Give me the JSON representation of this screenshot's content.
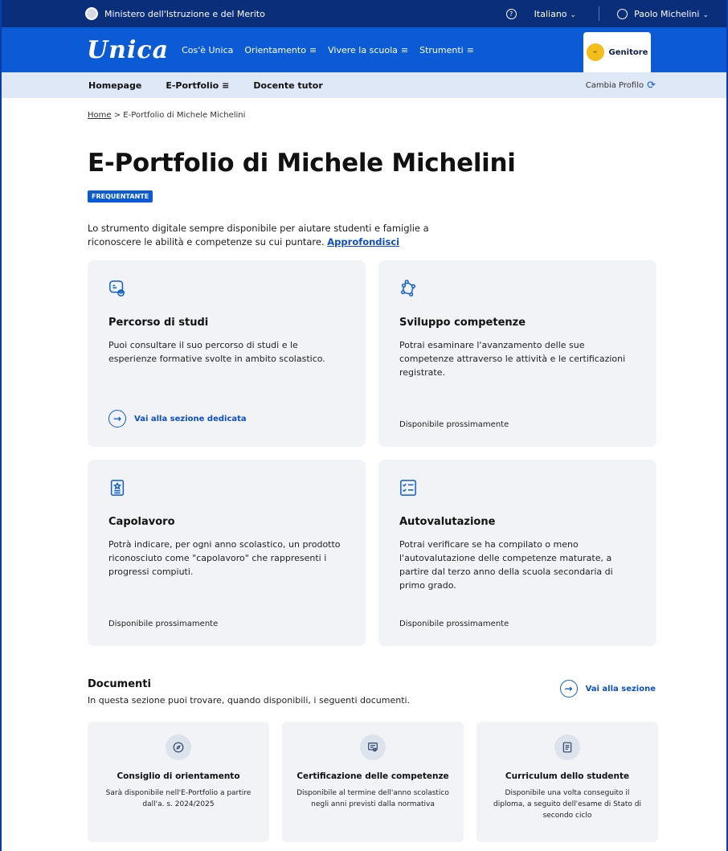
{
  "topbar": {
    "ministry": "Ministero dell'Istruzione e del Merito",
    "language": "Italiano",
    "user": "Paolo Michelini"
  },
  "mainnav": {
    "logo": "Unica",
    "items": [
      "Cos'è Unica",
      "Orientamento",
      "Vivere la scuola",
      "Strumenti"
    ],
    "profile": "Genitore"
  },
  "subnav": {
    "items": [
      "Homepage",
      "E-Portfolio",
      "Docente tutor"
    ],
    "cambia": "Cambia Profilo"
  },
  "breadcrumb": {
    "home": "Home",
    "sep": ">",
    "current": "E-Portfolio di Michele Michelini"
  },
  "page": {
    "title": "E-Portfolio di Michele Michelini",
    "badge": "FREQUENTANTE",
    "intro": "Lo strumento digitale sempre disponibile per aiutare studenti e famiglie a riconoscere le abilità e competenze su cui puntare.",
    "intro_link": "Approfondisci"
  },
  "cards": [
    {
      "title": "Percorso di studi",
      "text": "Puoi consultare il suo percorso di studi e le esperienze formative svolte in ambito scolastico.",
      "link": "Vai alla sezione dedicata",
      "icon": "student-chat-icon"
    },
    {
      "title": "Sviluppo competenze",
      "text": "Potrai esaminare l'avanzamento delle sue competenze attraverso le attività e le certificazioni registrate.",
      "footer": "Disponibile prossimamente",
      "icon": "polygon-nodes-icon"
    },
    {
      "title": "Capolavoro",
      "text": "Potrà indicare, per ogni anno scolastico, un prodotto riconosciuto come \"capolavoro\" che rappresenti i progressi compiuti.",
      "footer": "Disponibile prossimamente",
      "icon": "star-document-icon"
    },
    {
      "title": "Autovalutazione",
      "text": "Potrai verificare se ha compilato o meno l'autovalutazione delle competenze maturate, a partire dal terzo anno della scuola secondaria di primo grado.",
      "footer": "Disponibile prossimamente",
      "icon": "checklist-icon"
    }
  ],
  "documents": {
    "title": "Documenti",
    "subtitle": "In questa sezione puoi trovare, quando disponibili, i seguenti documenti.",
    "link": "Vai alla sezione",
    "items": [
      {
        "title": "Consiglio di orientamento",
        "text": "Sarà disponibile nell'E-Portfolio a partire dall'a. s. 2024/2025",
        "icon": "compass-icon"
      },
      {
        "title": "Certificazione delle competenze",
        "text": "Disponibile al termine dell'anno scolastico negli anni previsti dalla normativa",
        "icon": "certificate-icon"
      },
      {
        "title": "Curriculum dello studente",
        "text": "Disponibile una volta conseguito il diploma, a seguito dell'esame di Stato di secondo ciclo",
        "icon": "curriculum-icon"
      }
    ]
  }
}
